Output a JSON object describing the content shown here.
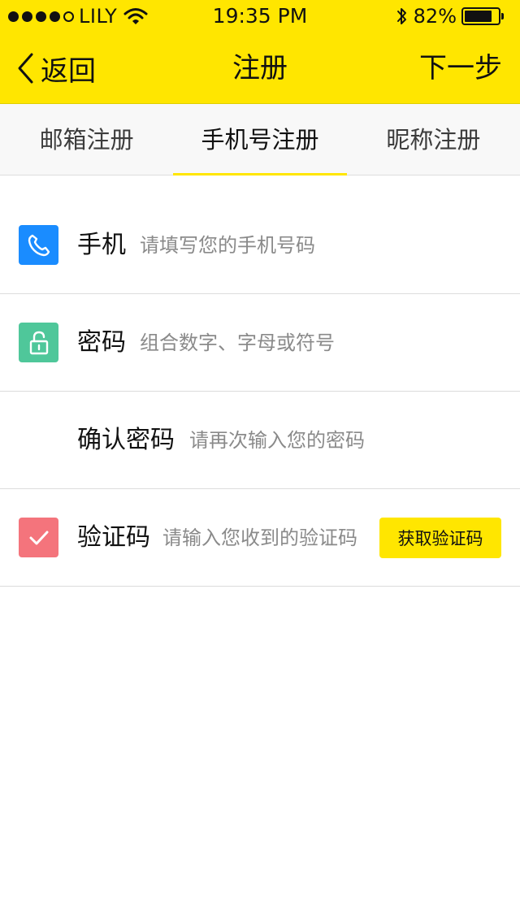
{
  "status_bar": {
    "carrier": "LILY",
    "time": "19:35 PM",
    "battery": "82%",
    "battery_level": 0.82,
    "signal_bars_filled": 4,
    "signal_bars_total": 5
  },
  "nav": {
    "back_label": "返回",
    "title": "注册",
    "next_label": "下一步"
  },
  "tabs": [
    {
      "label": "邮箱注册",
      "active": false
    },
    {
      "label": "手机号注册",
      "active": true
    },
    {
      "label": "昵称注册",
      "active": false
    }
  ],
  "form": {
    "phone": {
      "label": "手机",
      "placeholder": "请填写您的手机号码",
      "value": "",
      "icon": "phone-icon"
    },
    "password": {
      "label": "密码",
      "placeholder": "组合数字、字母或符号",
      "value": "",
      "icon": "unlock-icon"
    },
    "confirm": {
      "label": "确认密码",
      "placeholder": "请再次输入您的密码",
      "value": ""
    },
    "captcha": {
      "label": "验证码",
      "placeholder": "请输入您收到的验证码",
      "value": "",
      "icon": "checkmark-icon",
      "button_label": "获取验证码"
    }
  },
  "colors": {
    "accent": "#ffe600",
    "phone_icon_bg": "#1a8cff",
    "lock_icon_bg": "#4fc79a",
    "check_icon_bg": "#f4747c"
  }
}
